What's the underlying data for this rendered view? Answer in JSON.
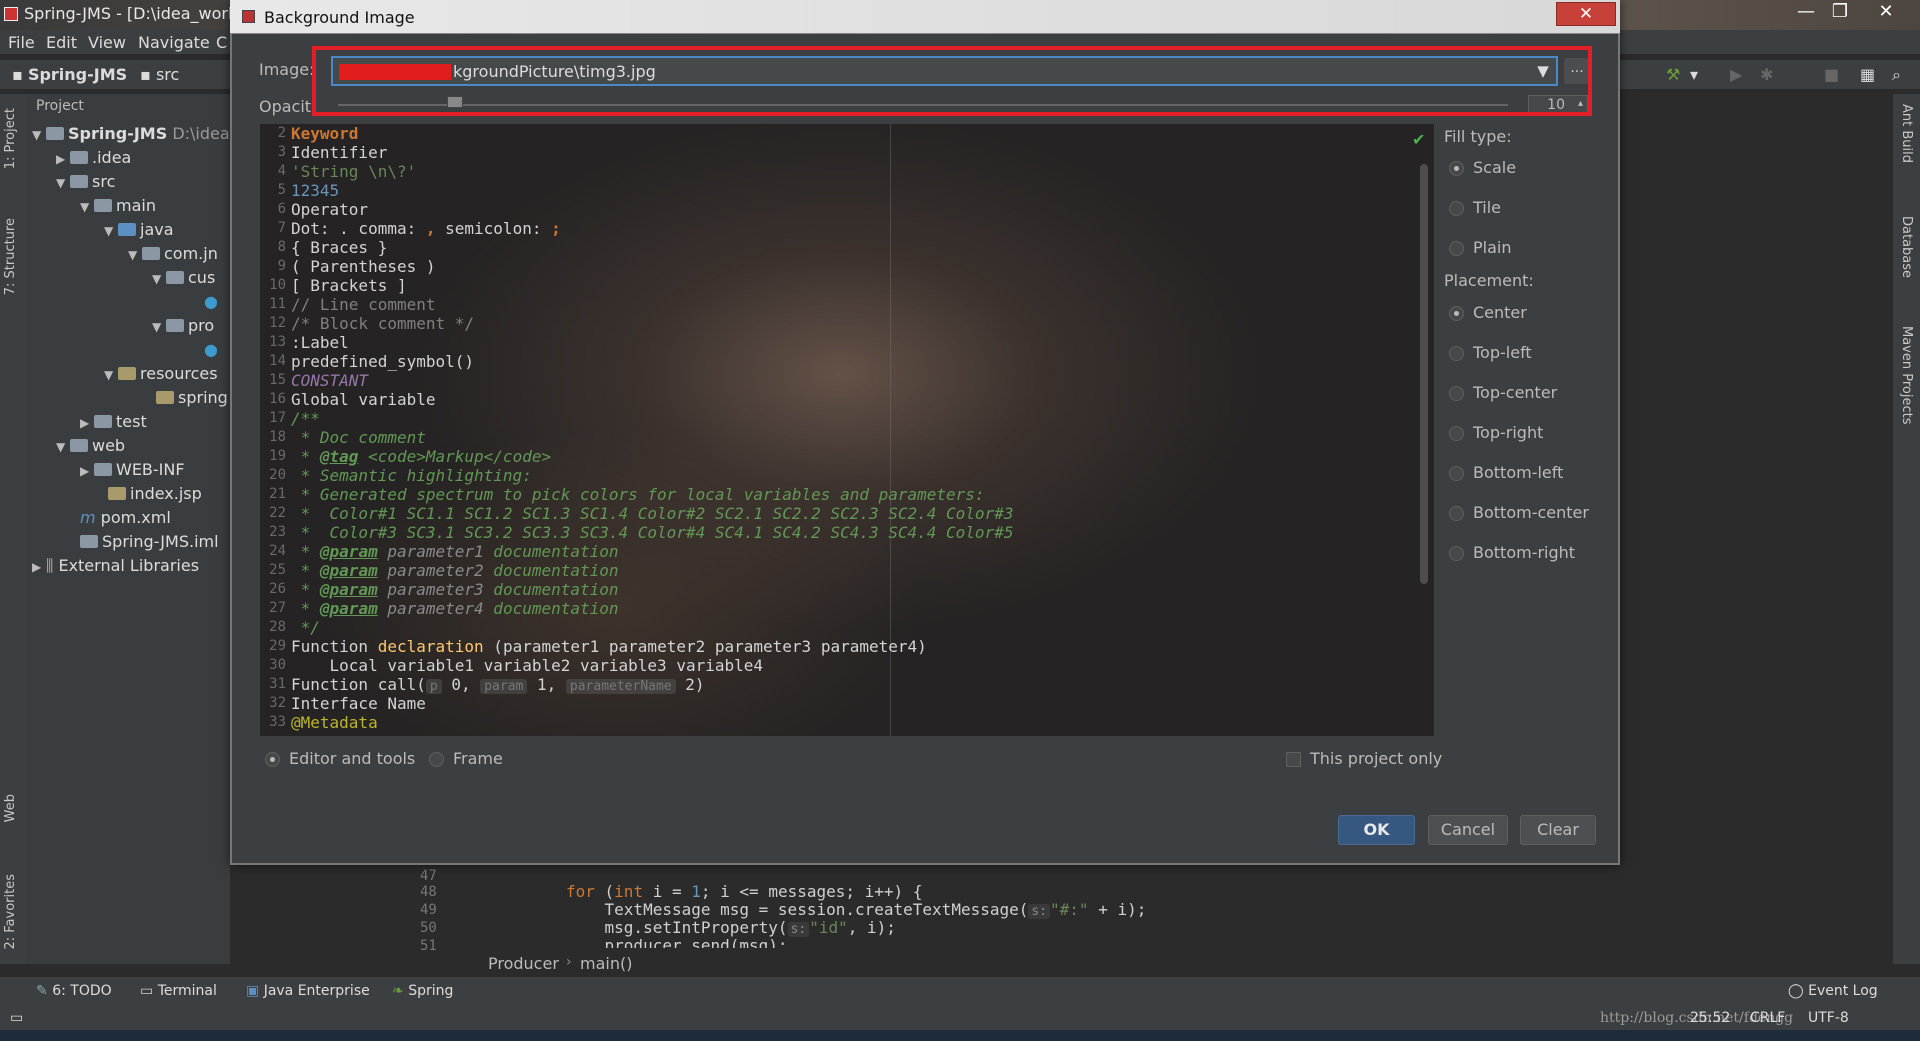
{
  "ide": {
    "window_title": "Spring-JMS - [D:\\idea_works",
    "menu": [
      "File",
      "Edit",
      "View",
      "Navigate",
      "C"
    ],
    "nav_crumbs": [
      "Spring-JMS",
      "src"
    ],
    "project_header": "Project",
    "tree": [
      {
        "label": "Spring-JMS",
        "extra": "D:\\idea"
      },
      {
        "label": ".idea"
      },
      {
        "label": "src"
      },
      {
        "label": "main"
      },
      {
        "label": "java"
      },
      {
        "label": "com.jn"
      },
      {
        "label": "cus"
      },
      {
        "label": "pro"
      },
      {
        "label": "resources"
      },
      {
        "label": "spring"
      },
      {
        "label": "test"
      },
      {
        "label": "web"
      },
      {
        "label": "WEB-INF"
      },
      {
        "label": "index.jsp"
      },
      {
        "label": "pom.xml"
      },
      {
        "label": "Spring-JMS.iml"
      },
      {
        "label": "External Libraries"
      }
    ],
    "left_tabs": [
      "1: Project",
      "7: Structure",
      "Web",
      "2: Favorites"
    ],
    "right_tabs": [
      "Ant Build",
      "Database",
      "Maven Projects"
    ],
    "editor": {
      "line_numbers": [
        "47",
        "48",
        "49",
        "50",
        "51"
      ],
      "line48_kw": "for",
      "line48_a": " (",
      "line48_int": "int",
      "line48_b": " i = ",
      "line48_one": "1",
      "line48_c": "; i <= messages; i++) {",
      "line49_a": "    TextMessage msg = session.createTextMessage(",
      "line49_hint": "s:",
      "line49_str": "\"#:\"",
      "line49_b": " + i);",
      "line50_a": "    msg.setIntProperty(",
      "line50_hint": "s:",
      "line50_str": "\"id\"",
      "line50_b": ", i);",
      "line51": "    producer.send(msg);"
    },
    "breadcrumb": [
      "Producer",
      "main()"
    ],
    "bottom_tabs": [
      "6: TODO",
      "Terminal",
      "Java Enterprise",
      "Spring"
    ],
    "event_log": "Event Log",
    "status": {
      "position": "25:52",
      "line_sep": "CRLF",
      "encoding": "UTF-8",
      "watermark": "http://blog.csdn.net/fdengg"
    }
  },
  "dialog": {
    "title": "Background Image",
    "close_label": "✕",
    "image_label": "Image:",
    "image_value": "kgroundPicture\\timg3.jpg",
    "browse_label": "...",
    "opacity_label": "Opacit",
    "opacity_value": "10",
    "opacity_level_percent": 10,
    "preview_lines": [
      {
        "n": "2"
      },
      {
        "n": "3"
      },
      {
        "n": "4"
      },
      {
        "n": "5"
      },
      {
        "n": "6"
      },
      {
        "n": "7"
      },
      {
        "n": "8"
      },
      {
        "n": "9"
      },
      {
        "n": "10"
      },
      {
        "n": "11"
      },
      {
        "n": "12"
      },
      {
        "n": "13"
      },
      {
        "n": "14"
      },
      {
        "n": "15"
      },
      {
        "n": "16"
      },
      {
        "n": "17"
      },
      {
        "n": "18"
      },
      {
        "n": "19"
      },
      {
        "n": "20"
      },
      {
        "n": "21"
      },
      {
        "n": "22"
      },
      {
        "n": "23"
      },
      {
        "n": "24"
      },
      {
        "n": "25"
      },
      {
        "n": "26"
      },
      {
        "n": "27"
      },
      {
        "n": "28"
      },
      {
        "n": "29"
      },
      {
        "n": "30"
      },
      {
        "n": "31"
      },
      {
        "n": "32"
      },
      {
        "n": "33"
      }
    ],
    "preview_text": {
      "l2": "Keyword",
      "l3": "Identifier",
      "l4": "'String \\n\\?'",
      "l5": "12345",
      "l6": "Operator",
      "l7a": "Dot: . comma: ",
      "l7b": ",",
      "l7c": " semicolon: ",
      "l7d": ";",
      "l8": "{ Braces }",
      "l9": "( Parentheses )",
      "l10": "[ Brackets ]",
      "l11": "// Line comment",
      "l12": "/* Block comment */",
      "l13": ":Label",
      "l14": "predefined_symbol()",
      "l15": "CONSTANT",
      "l16": "Global variable",
      "l17": "/**",
      "l18": " * Doc comment",
      "l19a": " * ",
      "l19tag": "@tag",
      "l19b": " <code>Markup</code>",
      "l20": " * Semantic highlighting:",
      "l21": " * Generated spectrum to pick colors for local variables and parameters:",
      "l22": " *  Color#1 SC1.1 SC1.2 SC1.3 SC1.4 Color#2 SC2.1 SC2.2 SC2.3 SC2.4 Color#3",
      "l23": " *  Color#3 SC3.1 SC3.2 SC3.3 SC3.4 Color#4 SC4.1 SC4.2 SC4.3 SC4.4 Color#5",
      "l24a": " * ",
      "l24tag": "@param",
      "l24p": " parameter1",
      "l24b": " documentation",
      "l25a": " * ",
      "l25tag": "@param",
      "l25p": " parameter2",
      "l25b": " documentation",
      "l26a": " * ",
      "l26tag": "@param",
      "l26p": " parameter3",
      "l26b": " documentation",
      "l27a": " * ",
      "l27tag": "@param",
      "l27p": " parameter4",
      "l27b": " documentation",
      "l28": " */",
      "l29a": "Function ",
      "l29b": "declaration",
      "l29c": " (parameter1 parameter2 parameter3 parameter4)",
      "l30": "    Local variable1 variable2 variable3 variable4",
      "l31a": "Function call(",
      "l31h1": "p",
      "l31b": " 0, ",
      "l31h2": "param",
      "l31c": " 1, ",
      "l31h3": "parameterName",
      "l31d": " 2)",
      "l32": "Interface Name",
      "l33": "@Metadata"
    },
    "fill_type_label": "Fill type:",
    "fill_types": [
      "Scale",
      "Tile",
      "Plain"
    ],
    "fill_selected": "Scale",
    "placement_label": "Placement:",
    "placements": [
      "Center",
      "Top-left",
      "Top-center",
      "Top-right",
      "Bottom-left",
      "Bottom-center",
      "Bottom-right"
    ],
    "placement_selected": "Center",
    "target_options": [
      "Editor and tools",
      "Frame"
    ],
    "target_selected": "Editor and tools",
    "this_project_only": "This project only",
    "buttons": {
      "ok": "OK",
      "cancel": "Cancel",
      "clear": "Clear"
    }
  },
  "colors": {
    "highlight_box": "#e41e27",
    "primary_button": "#365880",
    "focus_border": "#4a88c7"
  }
}
